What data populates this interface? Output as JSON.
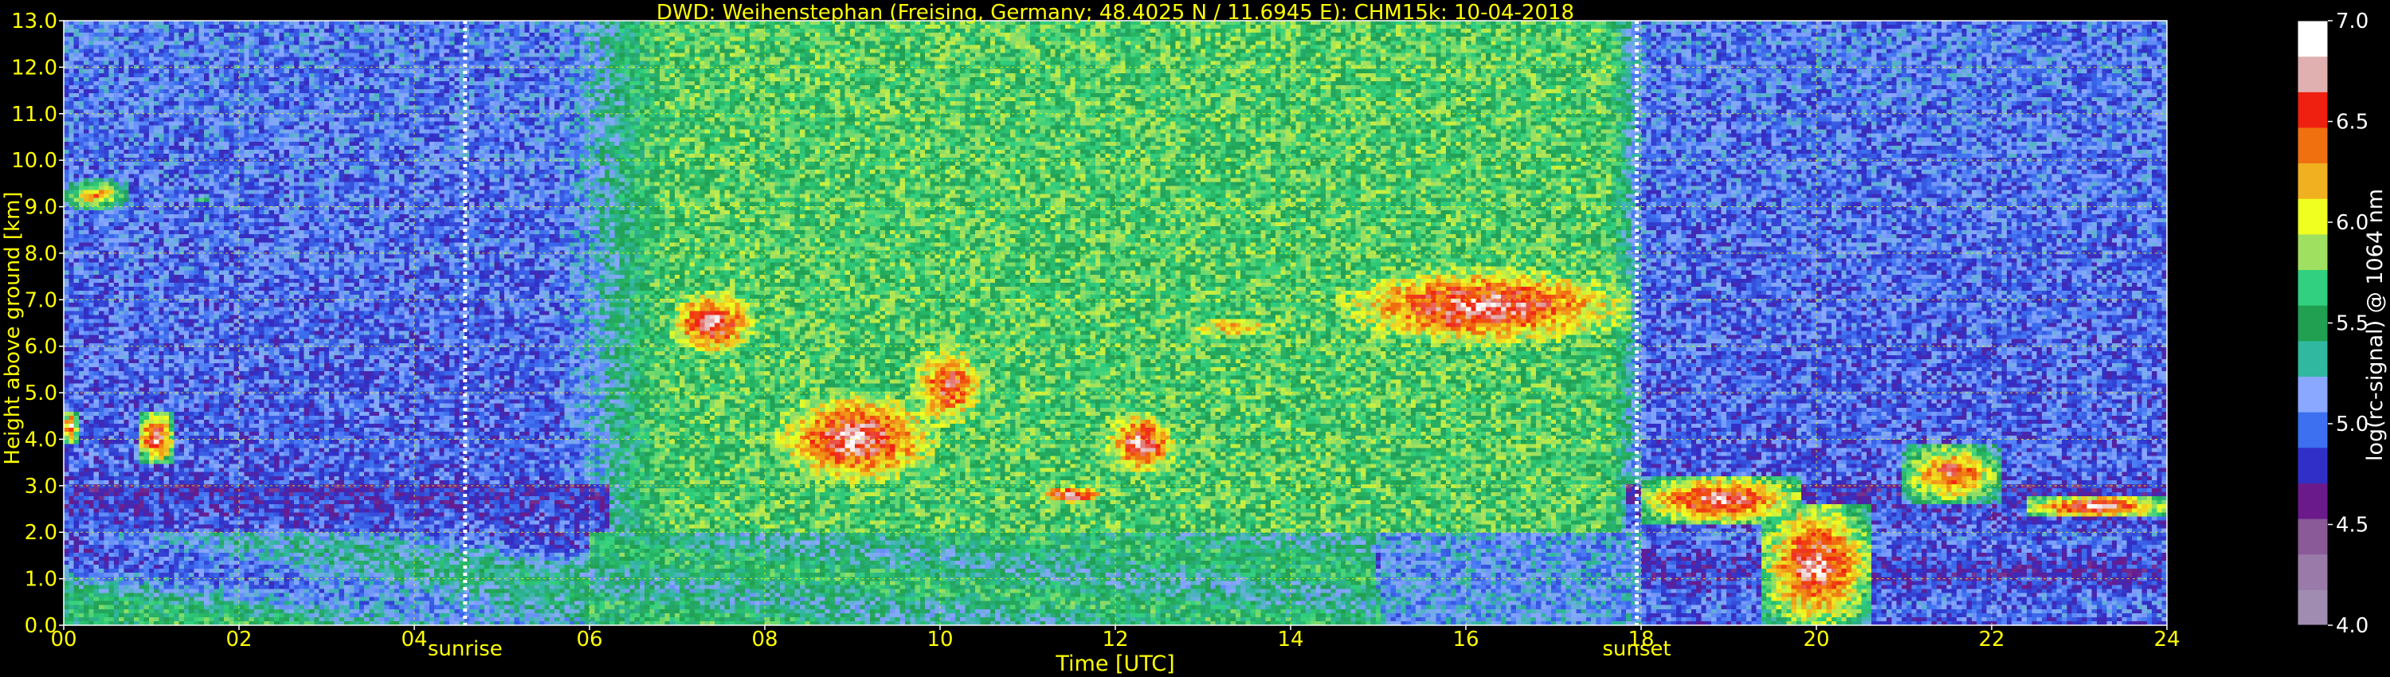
{
  "chart_data": {
    "type": "heatmap",
    "title": "DWD: Weihenstephan (Freising, Germany; 48.4025 N / 11.6945 E):    CHM15k: 10-04-2018",
    "xlabel": "Time [UTC]",
    "ylabel": "Height above ground [km]",
    "colorbar_label": "log(rc-signal) @ 1064 nm",
    "xlim": [
      0,
      24
    ],
    "ylim": [
      0,
      13
    ],
    "clim": [
      4.0,
      7.0
    ],
    "x_ticks": [
      "00",
      "02",
      "04",
      "06",
      "08",
      "10",
      "12",
      "14",
      "16",
      "18",
      "20",
      "22",
      "24"
    ],
    "y_ticks": [
      "0.0",
      "1.0",
      "2.0",
      "3.0",
      "4.0",
      "5.0",
      "6.0",
      "7.0",
      "8.0",
      "9.0",
      "10.0",
      "11.0",
      "12.0",
      "13.0"
    ],
    "colorbar_ticks": [
      "4.0",
      "4.5",
      "5.0",
      "5.5",
      "6.0",
      "6.5",
      "7.0"
    ],
    "grid": true,
    "annotations": [
      {
        "label": "sunrise",
        "time": 4.58
      },
      {
        "label": "sunset",
        "time": 17.95
      }
    ],
    "colormap": [
      "#a08cb0",
      "#9a7aa8",
      "#8a5a98",
      "#6a1a8a",
      "#3030c8",
      "#3c70f0",
      "#8aa8ff",
      "#30b8a0",
      "#20a050",
      "#30d080",
      "#a0e060",
      "#f0ff20",
      "#f0b020",
      "#f07010",
      "#f02010",
      "#e0b0b0",
      "#ffffff"
    ],
    "features": [
      {
        "kind": "cloud",
        "t": [
          0.0,
          0.75
        ],
        "base": 8.9,
        "top": 9.6,
        "max": 6.5
      },
      {
        "kind": "cloud",
        "t": [
          1.2,
          1.9
        ],
        "base": 9.0,
        "top": 9.3,
        "max": 5.6
      },
      {
        "kind": "cloud",
        "t": [
          0.0,
          0.15
        ],
        "base": 3.9,
        "top": 4.6,
        "max": 7.0
      },
      {
        "kind": "cloud",
        "t": [
          0.85,
          1.25
        ],
        "base": 3.5,
        "top": 4.6,
        "max": 7.0
      },
      {
        "kind": "cloud",
        "t": [
          6.9,
          7.9
        ],
        "base": 5.8,
        "top": 7.2,
        "max": 7.0
      },
      {
        "kind": "cloud",
        "t": [
          8.1,
          10.0
        ],
        "base": 3.0,
        "top": 5.0,
        "max": 7.0
      },
      {
        "kind": "cloud",
        "t": [
          9.6,
          10.6
        ],
        "base": 4.1,
        "top": 6.2,
        "max": 6.8
      },
      {
        "kind": "cloud",
        "t": [
          11.1,
          11.9
        ],
        "base": 2.6,
        "top": 3.0,
        "max": 7.0
      },
      {
        "kind": "cloud",
        "t": [
          11.9,
          12.7
        ],
        "base": 3.2,
        "top": 4.6,
        "max": 7.0
      },
      {
        "kind": "cloud",
        "t": [
          12.4,
          14.3
        ],
        "base": 6.0,
        "top": 6.8,
        "max": 6.4
      },
      {
        "kind": "cloud",
        "t": [
          14.5,
          17.9
        ],
        "base": 6.0,
        "top": 7.7,
        "max": 7.0
      },
      {
        "kind": "cloud",
        "t": [
          18.0,
          19.8
        ],
        "base": 2.2,
        "top": 3.2,
        "max": 7.0
      },
      {
        "kind": "cloud",
        "t": [
          19.4,
          20.6
        ],
        "base": 0.0,
        "top": 2.6,
        "max": 7.0
      },
      {
        "kind": "cloud",
        "t": [
          21.0,
          22.1
        ],
        "base": 2.6,
        "top": 3.9,
        "max": 6.8
      },
      {
        "kind": "cloud",
        "t": [
          22.4,
          24.0
        ],
        "base": 2.3,
        "top": 2.8,
        "max": 7.0
      },
      {
        "kind": "boundary_layer",
        "t": [
          0.0,
          24.0
        ],
        "top": 2.0,
        "min": 5.0,
        "max": 5.6
      }
    ]
  }
}
